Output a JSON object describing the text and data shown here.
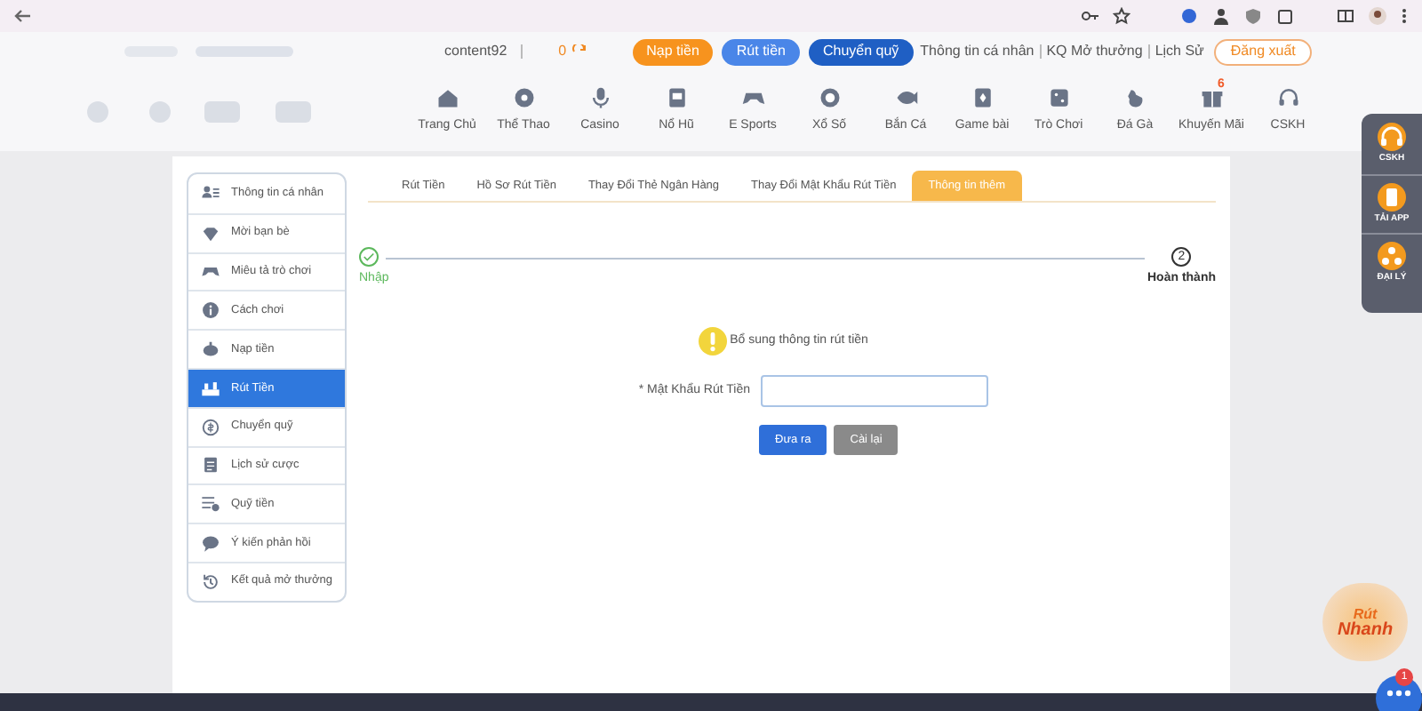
{
  "header": {
    "username": "content92",
    "balance": "0",
    "buttons": [
      {
        "label": "Nạp tiền",
        "kind": "deposit"
      },
      {
        "label": "Rút tiền",
        "kind": "withdraw"
      },
      {
        "label": "Chuyển quỹ",
        "kind": "transfer"
      }
    ],
    "links": [
      "Thông tin cá nhân",
      "KQ Mở thưởng",
      "Lịch Sử"
    ],
    "logout": "Đăng xuất"
  },
  "nav": [
    {
      "label": "Trang Chủ"
    },
    {
      "label": "Thể Thao"
    },
    {
      "label": "Casino"
    },
    {
      "label": "Nổ Hũ"
    },
    {
      "label": "E Sports"
    },
    {
      "label": "Xổ Số"
    },
    {
      "label": "Bắn Cá"
    },
    {
      "label": "Game bài"
    },
    {
      "label": "Trò Chơi"
    },
    {
      "label": "Đá Gà"
    },
    {
      "label": "Khuyến Mãi",
      "badge": "6"
    },
    {
      "label": "CSKH"
    }
  ],
  "sidebar": [
    {
      "label": "Thông tin cá nhân",
      "selected": false
    },
    {
      "label": "Mời bạn bè",
      "selected": false
    },
    {
      "label": "Miêu tả trò chơi",
      "selected": false
    },
    {
      "label": "Cách chơi",
      "selected": false
    },
    {
      "label": "Nạp tiền",
      "selected": false
    },
    {
      "label": "Rút Tiền",
      "selected": true
    },
    {
      "label": "Chuyển quỹ",
      "selected": false
    },
    {
      "label": "Lịch sử cược",
      "selected": false
    },
    {
      "label": "Quỹ tiền",
      "selected": false
    },
    {
      "label": "Ý kiến phản hồi",
      "selected": false
    },
    {
      "label": "Kết quả mở thưởng",
      "selected": false
    }
  ],
  "tabs": [
    {
      "label": "Rút Tiền",
      "selected": false
    },
    {
      "label": "Hồ Sơ Rút Tiền",
      "selected": false
    },
    {
      "label": "Thay Đổi Thẻ Ngân Hàng",
      "selected": false
    },
    {
      "label": "Thay Đổi Mật Khẩu Rút Tiền",
      "selected": false
    },
    {
      "label": "Thông tin thêm",
      "selected": true
    }
  ],
  "steps": [
    {
      "label": "Nhập",
      "done": true
    },
    {
      "number": "2",
      "label": "Hoàn thành",
      "done": false
    }
  ],
  "notice": "Bổ sung thông tin rút tiền",
  "form": {
    "label": "* Mật Khẩu Rút Tiền"
  },
  "actions": [
    {
      "label": "Đưa ra",
      "kind": "primary"
    },
    {
      "label": "Cài lại",
      "kind": "secondary"
    }
  ],
  "float_menu": [
    {
      "label": "CSKH"
    },
    {
      "label": "TẢI APP"
    },
    {
      "label": "ĐẠI LÝ"
    }
  ],
  "promo": {
    "lines": [
      "Rút",
      "Nhanh"
    ]
  },
  "chat": {
    "badge": "1"
  }
}
